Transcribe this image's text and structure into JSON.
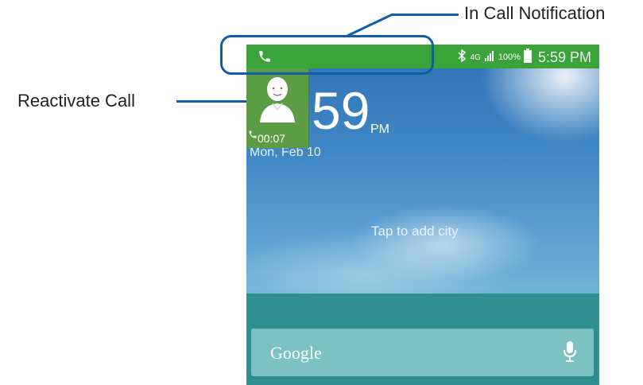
{
  "callouts": {
    "in_call": "In Call Notification",
    "reactivate": "Reactivate Call"
  },
  "status_bar": {
    "network": "4G",
    "battery": "100%",
    "time": "5:59 PM",
    "bar_color": "#3aa33a"
  },
  "lock_screen": {
    "clock": "59",
    "ampm": "PM",
    "date": "Mon, Feb 10",
    "weather_prompt": "Tap to add city"
  },
  "call_widget": {
    "duration": "00:07",
    "bg_color": "#5c9c45"
  },
  "search": {
    "label": "Google"
  },
  "accent_color": "#0f5ea6"
}
